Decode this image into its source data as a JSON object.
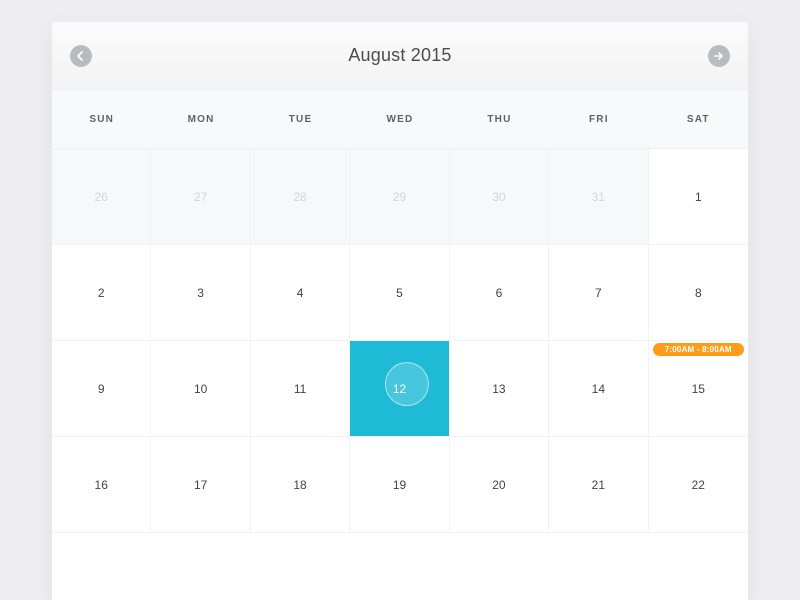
{
  "header": {
    "title": "August 2015",
    "prev_icon": "arrow-left",
    "next_icon": "arrow-right"
  },
  "weekdays": [
    "SUN",
    "MON",
    "TUE",
    "WED",
    "THU",
    "FRI",
    "SAT"
  ],
  "days": [
    {
      "label": "26",
      "other_month": true
    },
    {
      "label": "27",
      "other_month": true
    },
    {
      "label": "28",
      "other_month": true
    },
    {
      "label": "29",
      "other_month": true
    },
    {
      "label": "30",
      "other_month": true
    },
    {
      "label": "31",
      "other_month": true
    },
    {
      "label": "1"
    },
    {
      "label": "2"
    },
    {
      "label": "3"
    },
    {
      "label": "4"
    },
    {
      "label": "5"
    },
    {
      "label": "6"
    },
    {
      "label": "7"
    },
    {
      "label": "8"
    },
    {
      "label": "9"
    },
    {
      "label": "10"
    },
    {
      "label": "11"
    },
    {
      "label": "12",
      "selected": true,
      "ripple": true
    },
    {
      "label": "13"
    },
    {
      "label": "14"
    },
    {
      "label": "15",
      "event": "7:00AM - 8:00AM"
    },
    {
      "label": "16"
    },
    {
      "label": "17"
    },
    {
      "label": "18"
    },
    {
      "label": "19"
    },
    {
      "label": "20"
    },
    {
      "label": "21"
    },
    {
      "label": "22"
    }
  ],
  "colors": {
    "accent": "#1fbad6",
    "event_badge": "#ff9b1a",
    "nav_button": "#b9bcbf"
  }
}
